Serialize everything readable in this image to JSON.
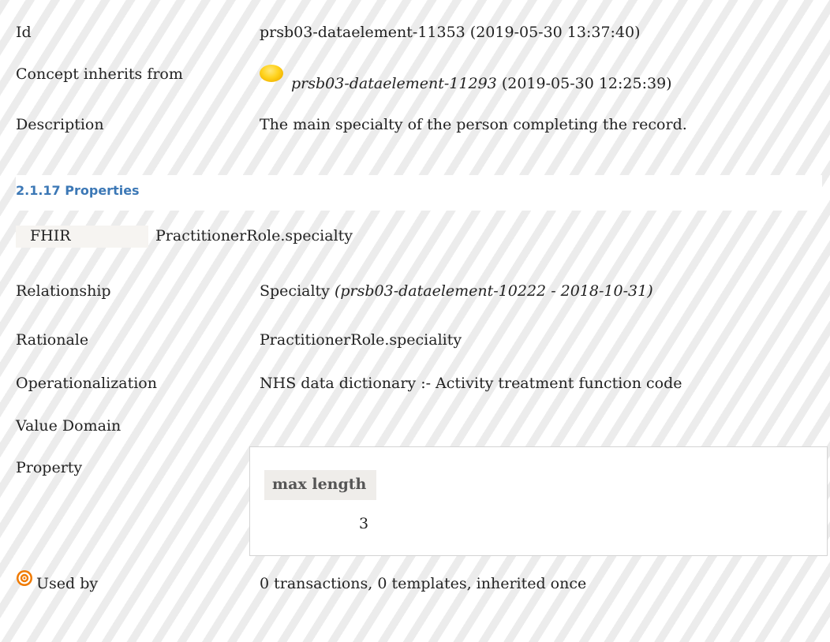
{
  "rows": {
    "id": {
      "label": "Id",
      "value": "prsb03-dataelement-11353 (2019-05-30 13:37:40)"
    },
    "inherits": {
      "label": "Concept inherits from",
      "ref": "prsb03-dataelement-11293",
      "date": "(2019-05-30 12:25:39)"
    },
    "description": {
      "label": "Description",
      "value": "The main specialty of the person completing the record."
    }
  },
  "section": {
    "title": "2.1.17 Properties"
  },
  "fhir": {
    "key": "FHIR",
    "value": "PractitionerRole.specialty"
  },
  "relationship": {
    "label": "Relationship",
    "value": "Specialty",
    "ref": "(prsb03-dataelement-10222 - 2018-10-31)"
  },
  "rationale": {
    "label": "Rationale",
    "value": "PractitionerRole.speciality"
  },
  "operationalization": {
    "label": "Operationalization",
    "value": "NHS data dictionary :- Activity treatment function code"
  },
  "value_domain": {
    "label": "Value Domain"
  },
  "property": {
    "label": "Property",
    "header": "max length",
    "value": "3"
  },
  "used_by": {
    "label": "Used by",
    "value": "0 transactions, 0 templates, inherited once",
    "icon": "target-icon"
  },
  "colors": {
    "accent": "#3c78b6",
    "concept_dot": "#ffd21c",
    "target_icon": "#f07a00"
  }
}
